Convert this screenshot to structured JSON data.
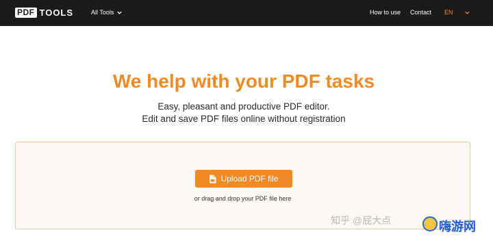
{
  "header": {
    "logo_box": "PDF",
    "logo_word": "TOOLS",
    "all_tools_label": "All Tools",
    "nav": {
      "how_to_use": "How to use",
      "contact": "Contact"
    },
    "language": "EN"
  },
  "hero": {
    "title": "We help with your PDF tasks",
    "subtitle_line1": "Easy, pleasant and productive PDF editor.",
    "subtitle_line2": "Edit and save PDF files online without registration"
  },
  "upload": {
    "button_label": "Upload PDF file",
    "hint": "or drag and drop your PDF file here"
  },
  "watermark": {
    "text": "知乎 @屁大点",
    "brand": "嗨游网"
  },
  "colors": {
    "accent": "#f08a24",
    "header_bg": "#1b1b1b",
    "dropzone_bg": "#fdf8f3",
    "dropzone_border": "#f3c79a"
  },
  "icons": [
    "chevron-down-icon",
    "file-icon"
  ]
}
